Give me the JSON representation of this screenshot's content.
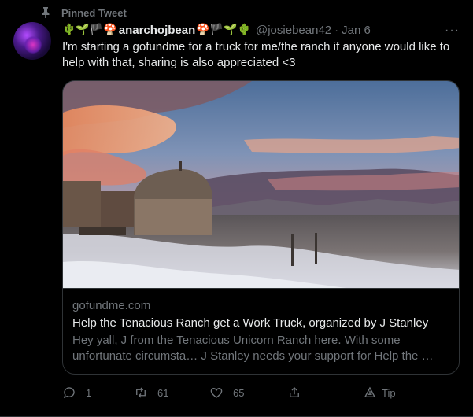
{
  "pinned": {
    "label": "Pinned Tweet"
  },
  "author": {
    "emoji_pre": "🌵🌱🏴🍄",
    "name": "anarchojbean",
    "emoji_post": "🍄🏴🌱🌵",
    "handle": "@josiebean42",
    "separator": "·",
    "date": "Jan 6"
  },
  "more_label": "···",
  "tweet_text": "I'm starting a gofundme for a truck for me/the ranch if anyone would like to help with that, sharing is also appreciated <3",
  "card": {
    "domain": "gofundme.com",
    "title": "Help the Tenacious Ranch get a Work Truck, organized by J Stanley",
    "description": "Hey yall, J from the Tenacious Unicorn Ranch here. With some unfortunate circumsta… J Stanley needs your support for Help the …"
  },
  "actions": {
    "reply_count": "1",
    "retweet_count": "61",
    "like_count": "65",
    "tip_label": "Tip"
  },
  "icons": {
    "pin": "pin-icon",
    "reply": "reply-icon",
    "retweet": "retweet-icon",
    "like": "heart-icon",
    "share": "share-icon",
    "tip": "tip-icon",
    "more": "more-icon"
  },
  "colors": {
    "background": "#000000",
    "text": "#e7e9ea",
    "muted": "#71767b",
    "border": "#2f3336"
  }
}
